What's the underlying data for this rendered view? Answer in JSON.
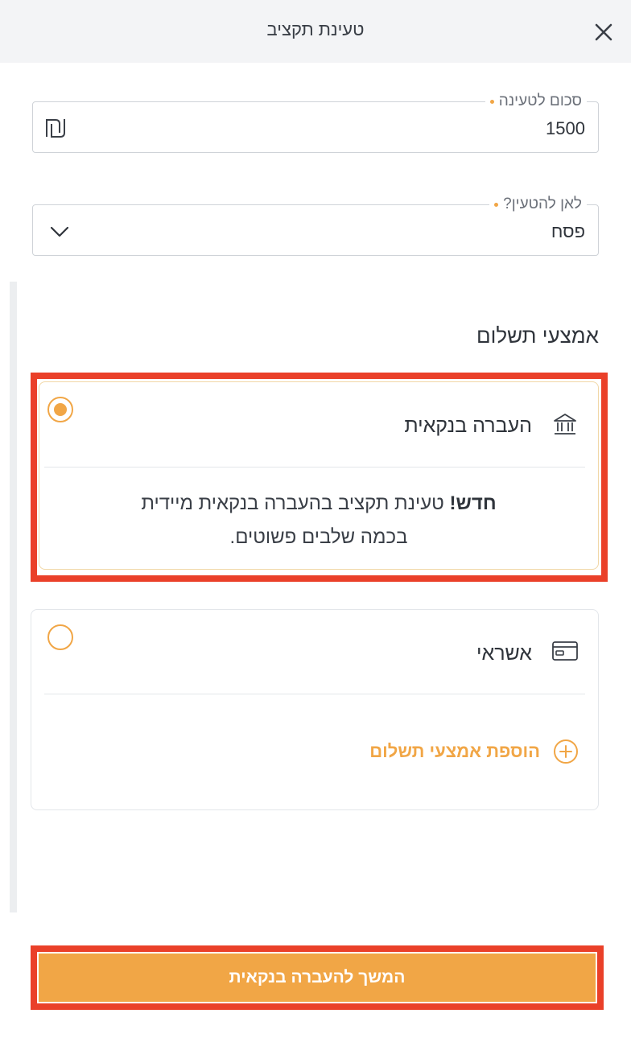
{
  "header": {
    "title": "טעינת תקציב",
    "close_icon": "close-icon"
  },
  "amount_field": {
    "label": "סכום לטעינה",
    "value": "1500",
    "currency_icon": "shekel-icon"
  },
  "target_field": {
    "label": "לאן להטעין?",
    "value": "פסח",
    "chevron_icon": "chevron-down-icon"
  },
  "payment": {
    "title": "אמצעי תשלום",
    "bank": {
      "label": "העברה בנקאית",
      "icon": "bank-icon",
      "selected": true,
      "promo_bold": "חדש!",
      "promo_text_line1": "טעינת תקציב בהעברה בנקאית מיידית",
      "promo_text_line2": "בכמה שלבים פשוטים."
    },
    "credit": {
      "label": "אשראי",
      "icon": "credit-card-icon",
      "selected": false,
      "add_method_label": "הוספת אמצעי תשלום",
      "add_icon": "plus-circle-icon"
    }
  },
  "cta": {
    "label": "המשך להעברה בנקאית"
  },
  "colors": {
    "accent": "#f1a646",
    "highlight": "#ea4029",
    "text": "#2f343b",
    "header_bg": "#f3f4f6"
  }
}
